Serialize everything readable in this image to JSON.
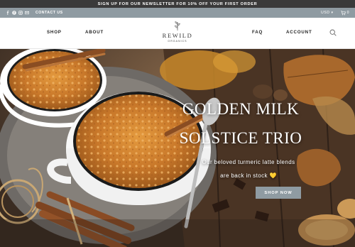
{
  "announcement": {
    "text": "SIGN UP FOR OUR NEWSLETTER FOR 10% OFF YOUR FIRST ORDER"
  },
  "utility": {
    "social_icons": [
      "facebook-icon",
      "pinterest-icon",
      "instagram-icon",
      "email-icon"
    ],
    "contact_label": "CONTACT US",
    "currency": "USD",
    "cart_count": "0"
  },
  "nav": {
    "left": [
      "SHOP",
      "ABOUT"
    ],
    "right": [
      "FAQ",
      "ACCOUNT"
    ],
    "logo": {
      "name": "REWILD",
      "sub": "ORGANICS"
    }
  },
  "hero": {
    "title_line1": "GOLDEN MILK",
    "title_line2": "SOLSTICE TRIO",
    "subtitle_line1": "Our beloved turmeric latte blends",
    "subtitle_line2": "are back in stock",
    "emoji": "💛",
    "cta": "SHOP NOW"
  },
  "colors": {
    "announcement_bg": "#3a3a3a",
    "utility_bg": "#8f9ba2",
    "button_bg": "#8f9ba2",
    "text_dark": "#222222"
  }
}
